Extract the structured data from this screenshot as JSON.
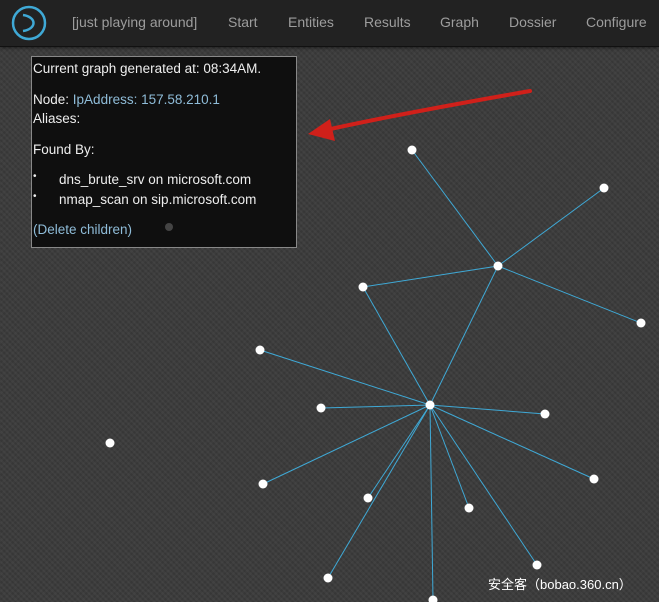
{
  "navbar": {
    "logo_icon": "ring-logo-icon",
    "items": [
      {
        "label": "[just playing around]"
      },
      {
        "label": "Start"
      },
      {
        "label": "Entities"
      },
      {
        "label": "Results"
      },
      {
        "label": "Graph"
      },
      {
        "label": "Dossier"
      },
      {
        "label": "Configure"
      }
    ]
  },
  "info_panel": {
    "generated_text": "Current graph generated at: 08:34AM.",
    "node_label": "Node:",
    "node_value": "IpAddress: 157.58.210.1",
    "aliases_label": "Aliases:",
    "found_by_label": "Found By:",
    "found_by": [
      "dns_brute_srv on microsoft.com",
      "nmap_scan on sip.microsoft.com"
    ],
    "delete_children": "(Delete children)"
  },
  "annotation": {
    "icon": "red-arrow-icon",
    "color": "#d0201a"
  },
  "colors": {
    "edge": "#3fa9d6",
    "node": "#ffffff",
    "navbar": "#222222",
    "background": "#3a3a3a"
  },
  "watermark": "安全客（bobao.360.cn）"
}
